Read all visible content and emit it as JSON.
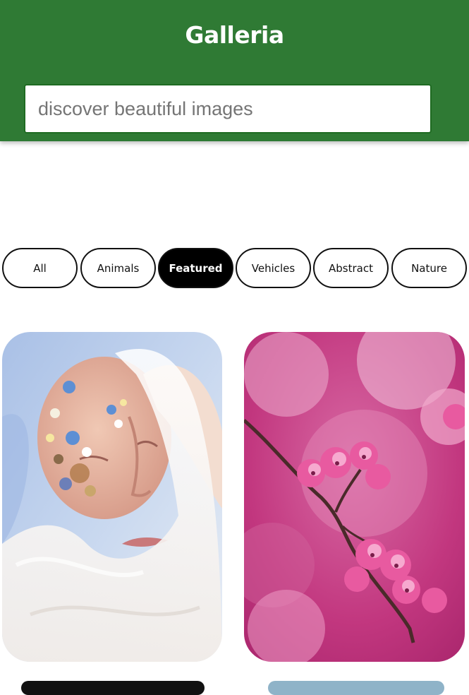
{
  "header": {
    "title": "Galleria",
    "background": "#2f7a34"
  },
  "search": {
    "placeholder": "discover beautiful images",
    "value": ""
  },
  "categories": [
    {
      "label": "All",
      "active": false
    },
    {
      "label": "Animals",
      "active": false
    },
    {
      "label": "Featured",
      "active": true
    },
    {
      "label": "Vehicles",
      "active": false
    },
    {
      "label": "Abstract",
      "active": false
    },
    {
      "label": "Nature",
      "active": false
    }
  ],
  "gallery": {
    "images": [
      {
        "subject": "portrait-with-flowers-and-veil"
      },
      {
        "subject": "pink-cherry-blossom-branch"
      }
    ]
  },
  "colors": {
    "chip_active_bg": "#000000",
    "chip_border": "#111111"
  }
}
